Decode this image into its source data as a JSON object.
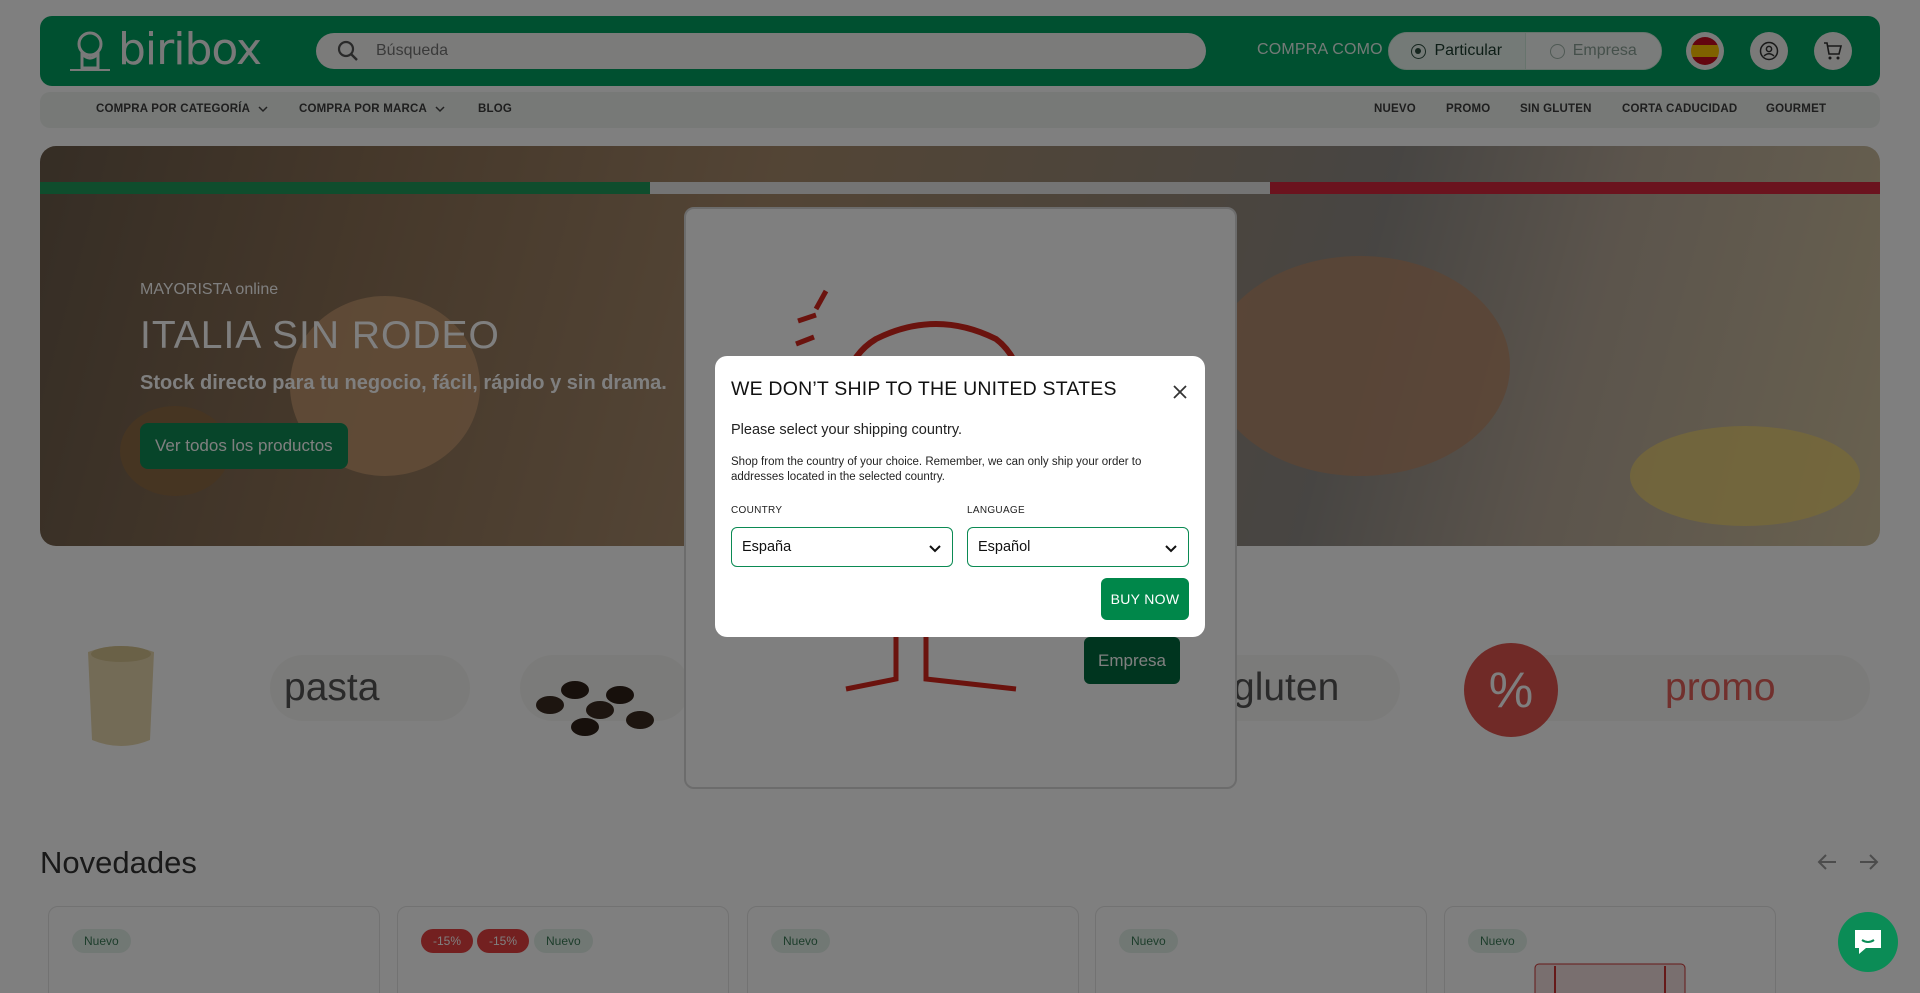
{
  "header": {
    "logo_text": "biribox",
    "search_placeholder": "Búsqueda",
    "buy_as_label": "COMPRA COMO",
    "toggle": {
      "particular": "Particular",
      "empresa": "Empresa"
    },
    "icons": [
      "spain-flag-icon",
      "user-icon",
      "cart-icon"
    ]
  },
  "nav": {
    "left": [
      "COMPRA POR CATEGORÍA",
      "COMPRA POR MARCA",
      "BLOG"
    ],
    "right": [
      "NUEVO",
      "PROMO",
      "SIN GLUTEN",
      "CORTA CADUCIDAD",
      "GOURMET"
    ]
  },
  "hero": {
    "subtitle": "MAYORISTA online",
    "title": "ITALIA SIN RODEO",
    "text": "Stock directo para tu negocio, fácil, rápido y sin drama.",
    "button": "Ver todos los productos",
    "bar_colors": [
      "#1f9a5a",
      "#e8e8e8",
      "#d7263d"
    ]
  },
  "categories": {
    "pasta": "pasta",
    "gluten": "gluten",
    "promo": "promo",
    "percent": "%"
  },
  "background_popup": {
    "button": "Empresa"
  },
  "novedades": {
    "title": "Novedades",
    "badges": {
      "new": "Nuevo",
      "discount": "-15%"
    }
  },
  "modal": {
    "title": "WE DON’T SHIP TO THE UNITED STATES",
    "subtitle": "Please select your shipping country.",
    "note": "Shop from the country of your choice. Remember, we can only ship your order to addresses located in the selected country.",
    "country_label": "COUNTRY",
    "country_value": "España",
    "language_label": "LANGUAGE",
    "language_value": "Español",
    "button": "BUY NOW"
  },
  "colors": {
    "brand": "#00a060",
    "button": "#00874a",
    "discount": "#e64040"
  }
}
